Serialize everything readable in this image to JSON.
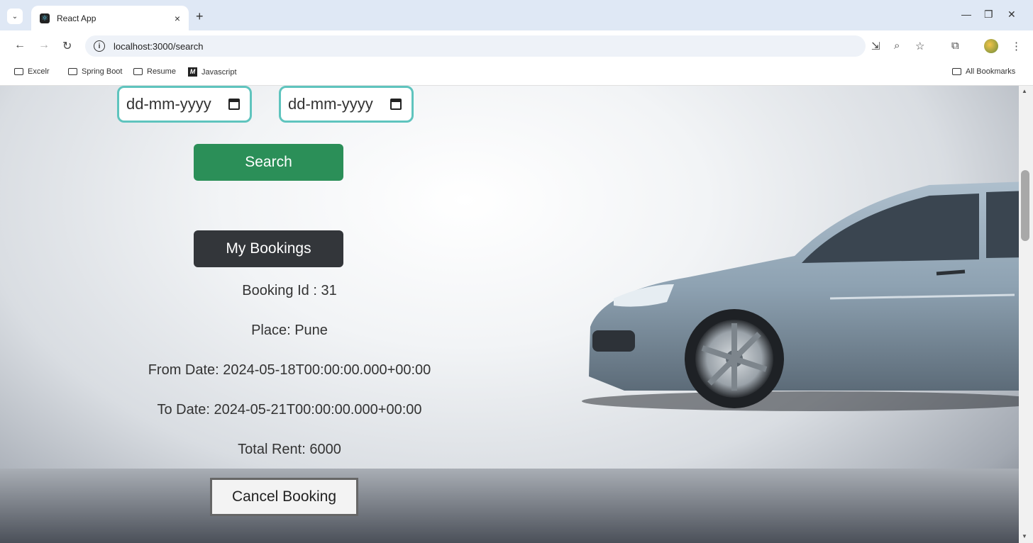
{
  "browser": {
    "tab_title": "React App",
    "tab_close": "×",
    "new_tab": "+",
    "url": "localhost:3000/search",
    "bookmarks": [
      {
        "label": "Excelr",
        "icon": "folder-icon"
      },
      {
        "label": "Spring Boot",
        "icon": "folder-icon"
      },
      {
        "label": "Resume",
        "icon": "folder-icon"
      },
      {
        "label": "Javascript",
        "icon": "m-logo-icon"
      }
    ],
    "all_bookmarks": "All Bookmarks"
  },
  "search": {
    "from_date_placeholder": "dd-mm-yyyy",
    "to_date_placeholder": "dd-mm-yyyy",
    "search_label": "Search"
  },
  "bookings": {
    "button_label": "My Bookings",
    "booking_id": "Booking Id : 31",
    "place": "Place: Pune",
    "from_date": "From Date: 2024-05-18T00:00:00.000+00:00",
    "to_date": "To Date: 2024-05-21T00:00:00.000+00:00",
    "total_rent": "Total Rent: 6000",
    "cancel_label": "Cancel Booking"
  },
  "colors": {
    "search_button": "#2b8f58",
    "bookings_button": "#33363a",
    "date_border": "#5fc4be"
  }
}
